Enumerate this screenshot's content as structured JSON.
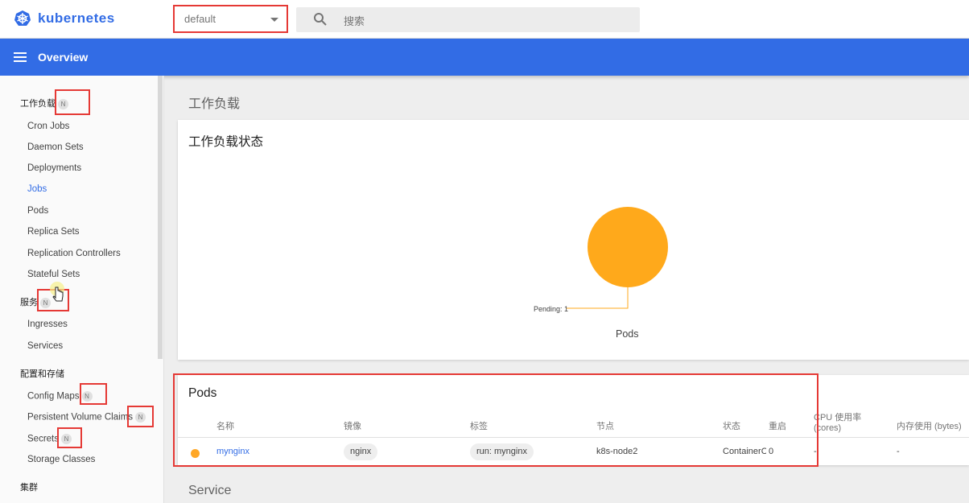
{
  "app": {
    "logo_text": "kubernetes"
  },
  "topbar": {
    "namespace": "default",
    "search_placeholder": "搜索"
  },
  "toolbar": {
    "title": "Overview"
  },
  "sidebar": {
    "badge": "N",
    "categories": {
      "workloads": "工作负载",
      "services": "服务",
      "config": "配置和存储",
      "cluster": "集群"
    },
    "workloads": [
      "Cron Jobs",
      "Daemon Sets",
      "Deployments",
      "Jobs",
      "Pods",
      "Replica Sets",
      "Replication Controllers",
      "Stateful Sets"
    ],
    "services": [
      "Ingresses",
      "Services"
    ],
    "config": [
      "Config Maps",
      "Persistent Volume Claims",
      "Secrets",
      "Storage Classes"
    ]
  },
  "main": {
    "section_workloads": "工作负载",
    "status_card_title": "工作负载状态",
    "chart_data": {
      "type": "pie",
      "title": "Pods",
      "slices": [
        {
          "label": "Pending",
          "value": 1,
          "color": "#ffa91b"
        }
      ],
      "annotation": "Pending: 1"
    },
    "pods_card": {
      "title": "Pods",
      "columns": [
        "名称",
        "镜像",
        "标签",
        "节点",
        "状态",
        "重启",
        "CPU 使用率 (cores)",
        "内存使用 (bytes)"
      ],
      "rows": [
        {
          "name": "mynginx",
          "image": "nginx",
          "labels": "run: mynginx",
          "node": "k8s-node2",
          "status": "ContainerC",
          "restarts": "0",
          "cpu": "-",
          "memory": "-"
        }
      ]
    },
    "section_service": "Service"
  },
  "colors": {
    "brand": "#326ce5",
    "accent_warning": "#ffa91b",
    "annotation": "#e53935"
  }
}
